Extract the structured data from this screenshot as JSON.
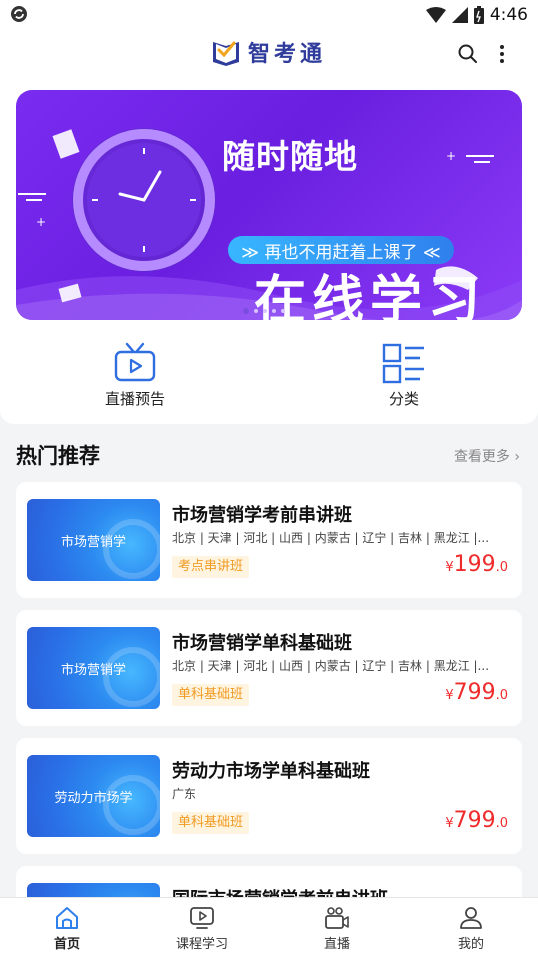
{
  "status_bar": {
    "time": "4:46"
  },
  "header": {
    "logo_text": "智考通"
  },
  "banner": {
    "title_line1": "随时随地",
    "title_line2": "在线学习",
    "pill_text": "≫ 再也不用赶着上课了 ≪",
    "page_count": 5,
    "active_page": 1
  },
  "quick_entries": [
    {
      "label": "直播预告",
      "icon": "tv-play-icon"
    },
    {
      "label": "分类",
      "icon": "category-list-icon"
    }
  ],
  "section": {
    "title": "热门推荐",
    "more_label": "查看更多"
  },
  "courses": [
    {
      "thumb_text": "市场营销学",
      "title": "市场营销学考前串讲班",
      "regions": "北京 | 天津 | 河北 | 山西 | 内蒙古 | 辽宁 | 吉林 | 黑龙江 |...",
      "tag": "考点串讲班",
      "price_symbol": "¥",
      "price_int": "199",
      "price_dec": ".0"
    },
    {
      "thumb_text": "市场营销学",
      "title": "市场营销学单科基础班",
      "regions": "北京 | 天津 | 河北 | 山西 | 内蒙古 | 辽宁 | 吉林 | 黑龙江 |...",
      "tag": "单科基础班",
      "price_symbol": "¥",
      "price_int": "799",
      "price_dec": ".0"
    },
    {
      "thumb_text": "劳动力市场学",
      "title": "劳动力市场学单科基础班",
      "regions": "广东",
      "tag": "单科基础班",
      "price_symbol": "¥",
      "price_int": "799",
      "price_dec": ".0"
    },
    {
      "thumb_text": "",
      "title": "国际市场营销学考前串讲班",
      "regions": "",
      "tag": "",
      "price_symbol": "",
      "price_int": "",
      "price_dec": ""
    }
  ],
  "bottom_nav": [
    {
      "label": "首页",
      "icon": "home-icon",
      "active": true
    },
    {
      "label": "课程学习",
      "icon": "course-play-icon",
      "active": false
    },
    {
      "label": "直播",
      "icon": "live-camera-icon",
      "active": false
    },
    {
      "label": "我的",
      "icon": "user-icon",
      "active": false
    }
  ],
  "colors": {
    "accent": "#2f80ed",
    "price": "#f02b2b",
    "tag_text": "#f19b22",
    "tag_bg": "#fff4e0",
    "banner": "#7a2cf0"
  }
}
